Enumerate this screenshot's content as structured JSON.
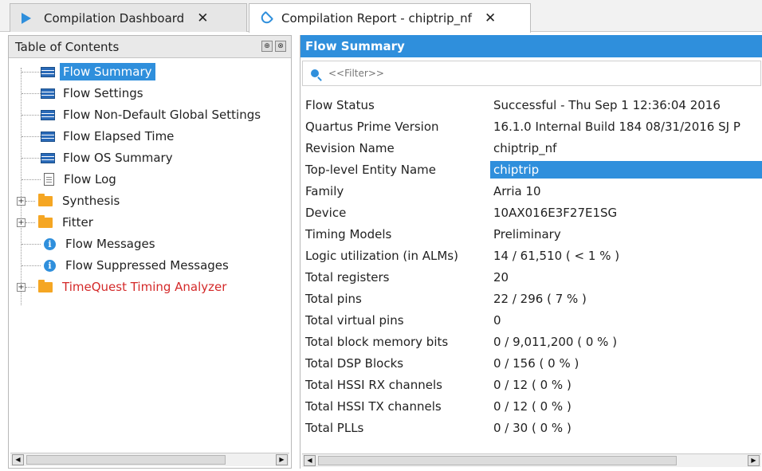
{
  "tabs": [
    {
      "label": "Compilation Dashboard"
    },
    {
      "label": "Compilation Report - chiptrip_nf"
    }
  ],
  "toc": {
    "title": "Table of Contents",
    "items": [
      {
        "label": "Flow Summary",
        "icon": "grid-table-icon",
        "selected": true
      },
      {
        "label": "Flow Settings",
        "icon": "grid-table-icon"
      },
      {
        "label": "Flow Non-Default Global Settings",
        "icon": "grid-table-icon"
      },
      {
        "label": "Flow Elapsed Time",
        "icon": "grid-table-icon"
      },
      {
        "label": "Flow OS Summary",
        "icon": "grid-table-icon"
      },
      {
        "label": "Flow Log",
        "icon": "document-icon"
      },
      {
        "label": "Synthesis",
        "icon": "folder-icon",
        "expandable": true
      },
      {
        "label": "Fitter",
        "icon": "folder-icon",
        "expandable": true
      },
      {
        "label": "Flow Messages",
        "icon": "info-icon"
      },
      {
        "label": "Flow Suppressed Messages",
        "icon": "info-icon"
      },
      {
        "label": "TimeQuest Timing Analyzer",
        "icon": "folder-icon",
        "expandable": true,
        "color": "#d42a2a"
      }
    ]
  },
  "report": {
    "title": "Flow Summary",
    "filter_placeholder": "<<Filter>>",
    "rows": [
      {
        "key": "Flow Status",
        "value": "Successful - Thu Sep  1 12:36:04 2016"
      },
      {
        "key": "Quartus Prime Version",
        "value": "16.1.0 Internal Build 184 08/31/2016 SJ P"
      },
      {
        "key": "Revision Name",
        "value": "chiptrip_nf"
      },
      {
        "key": "Top-level Entity Name",
        "value": "chiptrip",
        "highlighted": true
      },
      {
        "key": "Family",
        "value": "Arria 10"
      },
      {
        "key": "Device",
        "value": "10AX016E3F27E1SG"
      },
      {
        "key": "Timing Models",
        "value": "Preliminary"
      },
      {
        "key": "Logic utilization (in ALMs)",
        "value": "14 / 61,510 ( < 1 % )"
      },
      {
        "key": "Total registers",
        "value": "20"
      },
      {
        "key": "Total pins",
        "value": "22 / 296 ( 7 % )"
      },
      {
        "key": "Total virtual pins",
        "value": "0"
      },
      {
        "key": "Total block memory bits",
        "value": "0 / 9,011,200 ( 0 % )"
      },
      {
        "key": "Total DSP Blocks",
        "value": "0 / 156 ( 0 % )"
      },
      {
        "key": "Total HSSI RX channels",
        "value": "0 / 12 ( 0 % )"
      },
      {
        "key": "Total HSSI TX channels",
        "value": "0 / 12 ( 0 % )"
      },
      {
        "key": "Total PLLs",
        "value": "0 / 30 ( 0 % )"
      }
    ]
  }
}
